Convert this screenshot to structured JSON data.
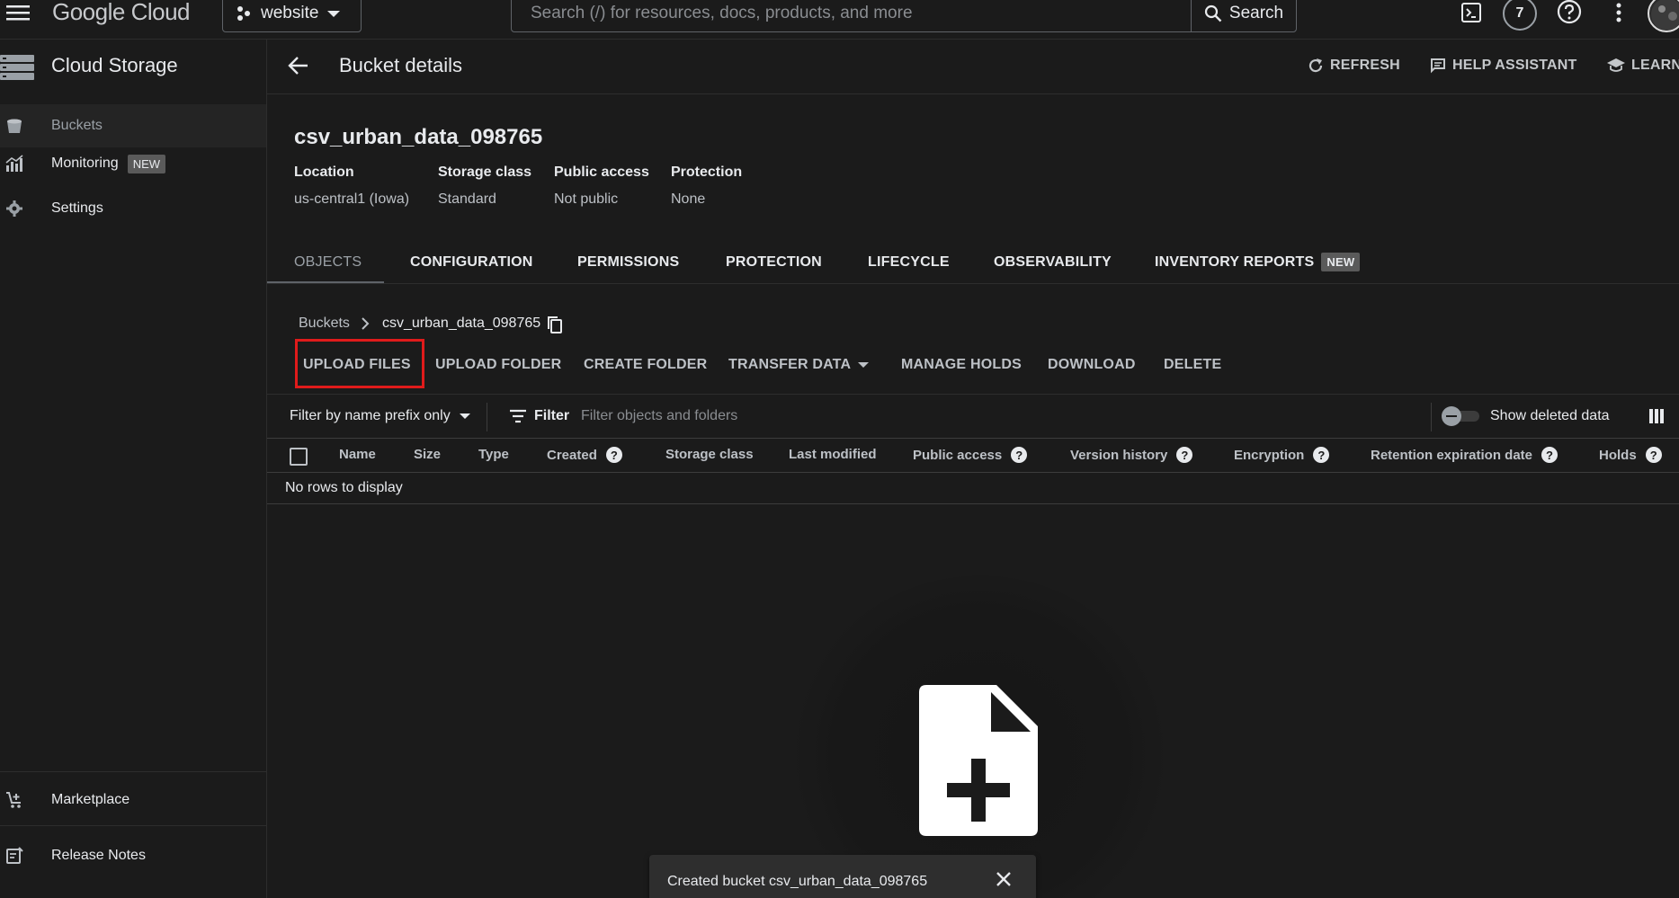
{
  "topbar": {
    "logo_text": "Google Cloud",
    "project_name": "website",
    "search_placeholder": "Search (/) for resources, docs, products, and more",
    "search_button": "Search",
    "notification_count": "7"
  },
  "sidebar": {
    "title": "Cloud Storage",
    "items": [
      {
        "label": "Buckets",
        "icon": "bucket-icon"
      },
      {
        "label": "Monitoring",
        "icon": "monitoring-icon",
        "badge": "NEW"
      },
      {
        "label": "Settings",
        "icon": "gear-icon"
      }
    ],
    "bottom_items": [
      {
        "label": "Marketplace",
        "icon": "cart-icon"
      },
      {
        "label": "Release Notes",
        "icon": "notes-icon"
      }
    ]
  },
  "header": {
    "title": "Bucket details",
    "actions": [
      "REFRESH",
      "HELP ASSISTANT",
      "LEARN"
    ]
  },
  "bucket": {
    "name": "csv_urban_data_098765",
    "meta": [
      {
        "label": "Location",
        "value": "us-central1 (Iowa)"
      },
      {
        "label": "Storage class",
        "value": "Standard"
      },
      {
        "label": "Public access",
        "value": "Not public"
      },
      {
        "label": "Protection",
        "value": "None"
      }
    ]
  },
  "tabs": [
    "OBJECTS",
    "CONFIGURATION",
    "PERMISSIONS",
    "PROTECTION",
    "LIFECYCLE",
    "OBSERVABILITY",
    "INVENTORY REPORTS"
  ],
  "tab_new_badge": "NEW",
  "breadcrumb": {
    "root": "Buckets",
    "current": "csv_urban_data_098765"
  },
  "toolbar": [
    "UPLOAD FILES",
    "UPLOAD FOLDER",
    "CREATE FOLDER",
    "TRANSFER DATA",
    "MANAGE HOLDS",
    "DOWNLOAD",
    "DELETE"
  ],
  "filter": {
    "mode": "Filter by name prefix only",
    "button": "Filter",
    "placeholder": "Filter objects and folders",
    "show_deleted": "Show deleted data"
  },
  "table": {
    "columns": [
      "Name",
      "Size",
      "Type",
      "Created",
      "Storage class",
      "Last modified",
      "Public access",
      "Version history",
      "Encryption",
      "Retention expiration date",
      "Holds"
    ],
    "empty": "No rows to display"
  },
  "snackbar": {
    "text": "Created bucket csv_urban_data_098765"
  },
  "colors": {
    "background": "#1b1b1b",
    "highlight": "#e01b1b"
  }
}
